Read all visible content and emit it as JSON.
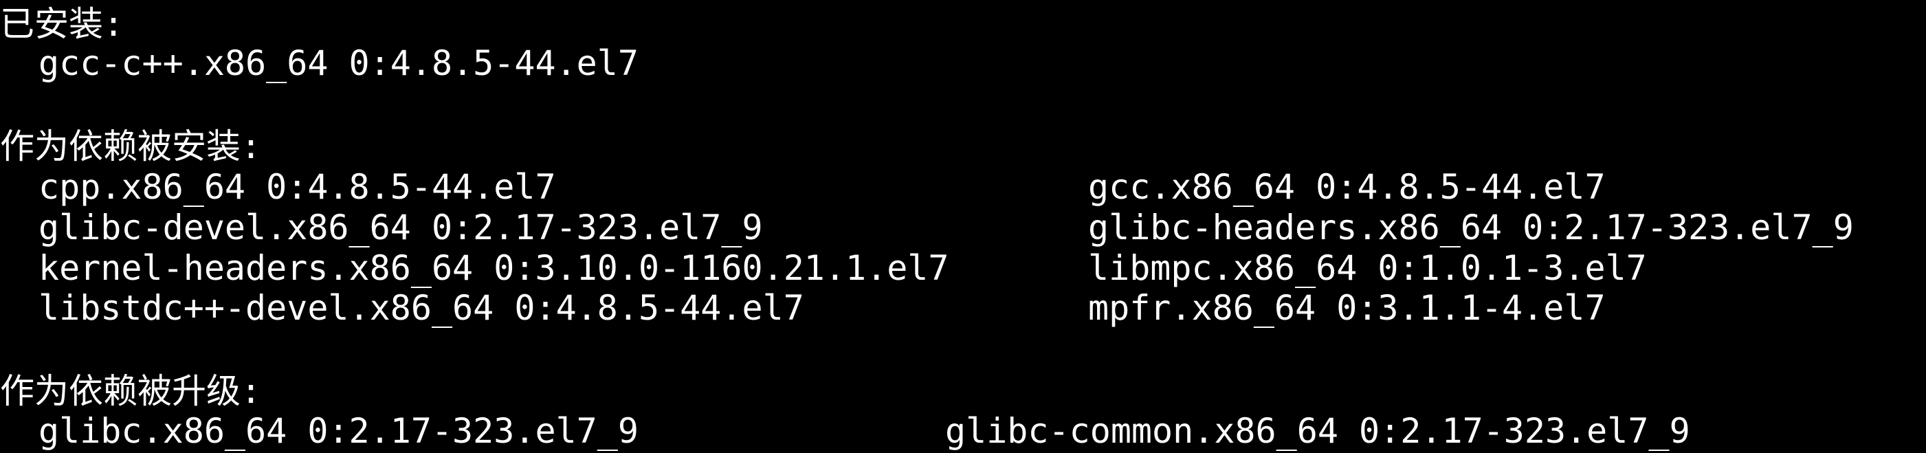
{
  "terminal": {
    "colors": {
      "background": "#000000",
      "foreground": "#ffffff"
    },
    "installed": {
      "heading": "已安装:",
      "packages": [
        "gcc-c++.x86_64 0:4.8.5-44.el7"
      ]
    },
    "dependency_installed": {
      "heading": "作为依赖被安装:",
      "packages": [
        "cpp.x86_64 0:4.8.5-44.el7",
        "gcc.x86_64 0:4.8.5-44.el7",
        "glibc-devel.x86_64 0:2.17-323.el7_9",
        "glibc-headers.x86_64 0:2.17-323.el7_9",
        "kernel-headers.x86_64 0:3.10.0-1160.21.1.el7",
        "libmpc.x86_64 0:1.0.1-3.el7",
        "libstdc++-devel.x86_64 0:4.8.5-44.el7",
        "mpfr.x86_64 0:3.1.1-4.el7"
      ]
    },
    "dependency_updated": {
      "heading": "作为依赖被升级:",
      "packages": [
        "glibc.x86_64 0:2.17-323.el7_9",
        "glibc-common.x86_64 0:2.17-323.el7_9"
      ]
    }
  }
}
